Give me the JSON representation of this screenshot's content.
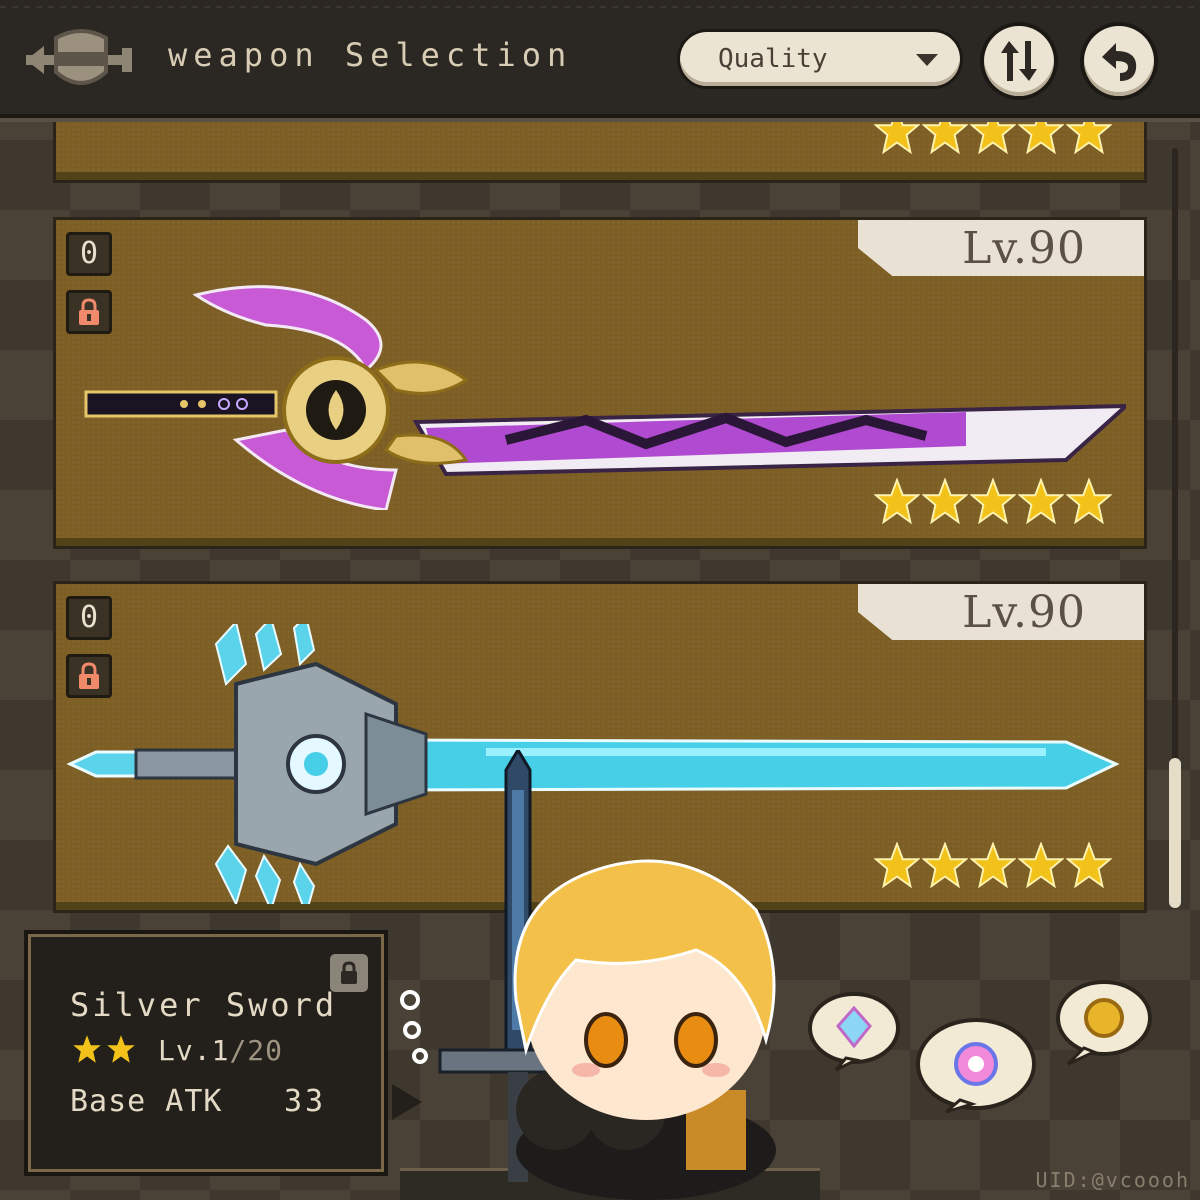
{
  "header": {
    "title": "weapon Selection",
    "sort_label": "Quality"
  },
  "colors": {
    "card_bg": "#7d5f25",
    "star": "#f2c21b",
    "badge_text": "#e8dfcc",
    "panel_text": "#e3d9c4"
  },
  "weapons": [
    {
      "rarity": 5
    },
    {
      "refinement": "0",
      "level": "Lv.90",
      "rarity": 5,
      "art": "purple-lightning-sword"
    },
    {
      "refinement": "0",
      "level": "Lv.90",
      "rarity": 5,
      "art": "crystal-blue-sword"
    }
  ],
  "selected_weapon": {
    "name": "Silver  Sword",
    "rarity": 2,
    "level": "Lv.1",
    "max_level": "/20",
    "stat_label": "Base ATK",
    "stat_value": "33"
  },
  "footer": {
    "uid": "UID:@vcoooh"
  },
  "icons": [
    "back-arrow-icon",
    "chevron-down-icon",
    "sort-order-icon",
    "return-icon",
    "lock-icon",
    "star-icon",
    "crystal-icon",
    "gem-icon",
    "coin-icon"
  ]
}
